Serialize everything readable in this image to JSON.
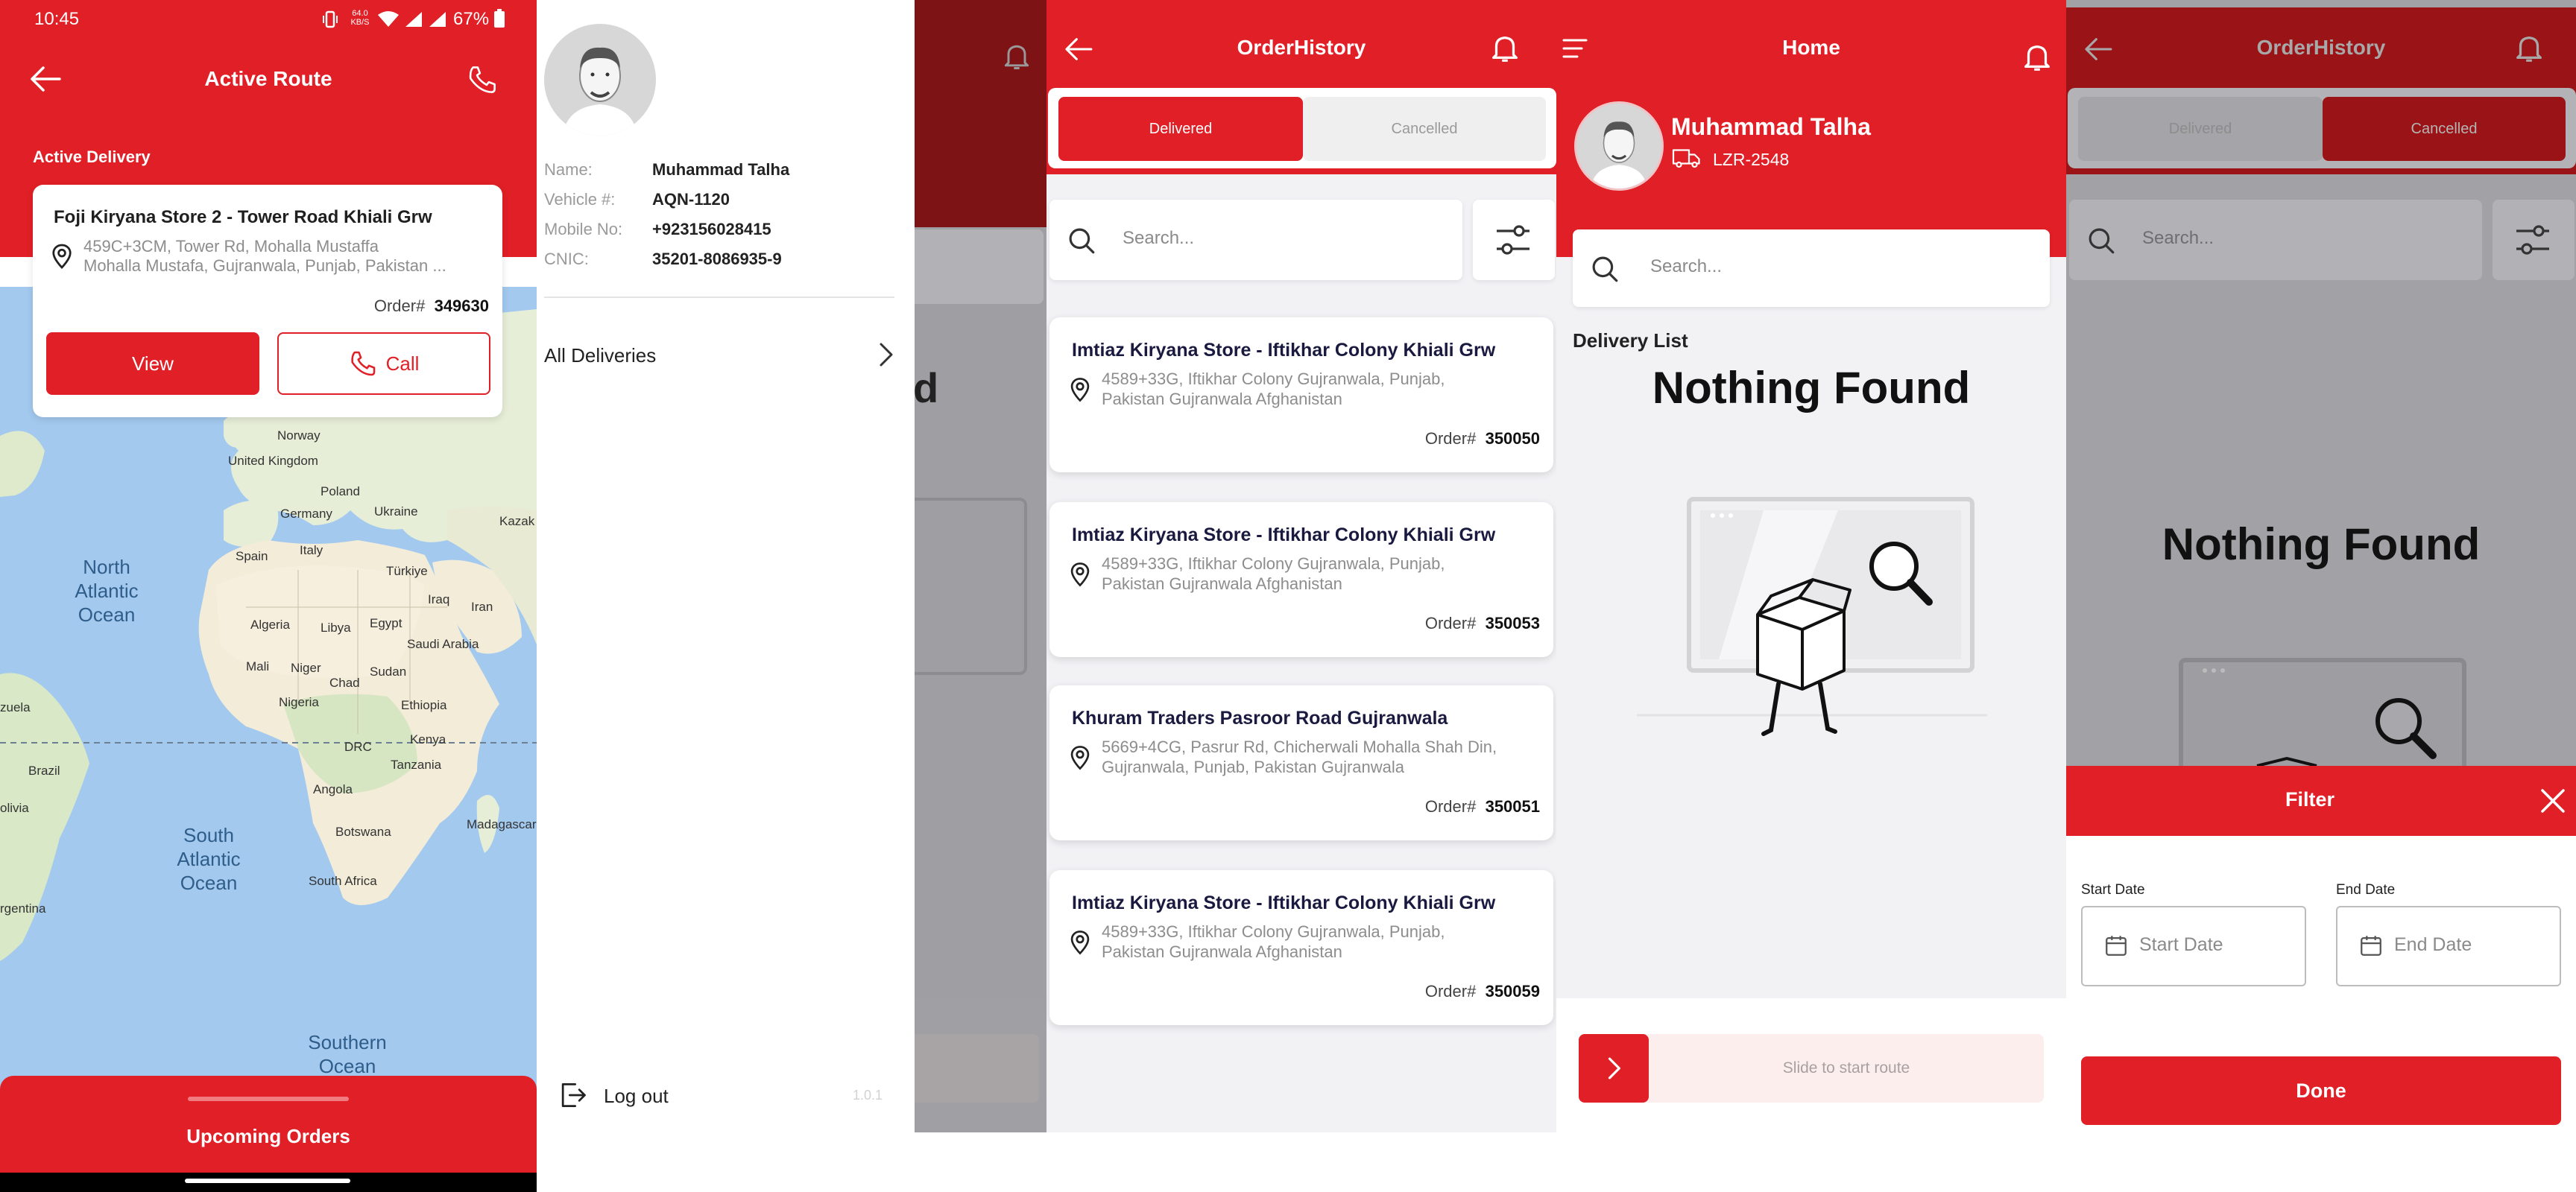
{
  "colors": {
    "primary": "#e11f26",
    "dark_primary": "#9c1318",
    "background": "#f2f1f4"
  },
  "status_bar": {
    "time": "10:45",
    "speed": "64.0 KB/S",
    "battery": "67%"
  },
  "active_route": {
    "title": "Active Route",
    "section_label": "Active Delivery",
    "store_name": "Foji  Kiryana Store 2 - Tower Road Khiali Grw",
    "address_line1": "459C+3CM, Tower Rd, Mohalla Mustaffa",
    "address_line2": "Mohalla Mustafa, Gujranwala, Punjab, Pakistan ...",
    "order_label": "Order#",
    "order_no": "349630",
    "view_label": "View",
    "call_label": "Call",
    "upcoming_label": "Upcoming Orders",
    "map_labels": {
      "norway": "Norway",
      "uk": "United Kingdom",
      "poland": "Poland",
      "germany": "Germany",
      "ukraine": "Ukraine",
      "kazak": "Kazak",
      "spain": "Spain",
      "italy": "Italy",
      "turkiye": "Türkiye",
      "iraq": "Iraq",
      "iran": "Iran",
      "algeria": "Algeria",
      "libya": "Libya",
      "egypt": "Egypt",
      "saudi": "Saudi Arabia",
      "mali": "Mali",
      "niger": "Niger",
      "chad": "Chad",
      "sudan": "Sudan",
      "ethiopia": "Ethiopia",
      "nigeria": "Nigeria",
      "kenya": "Kenya",
      "drc": "DRC",
      "tanzania": "Tanzania",
      "angola": "Angola",
      "brazil": "Brazil",
      "bolivia": "olivia",
      "zuela": "zuela",
      "botswana": "Botswana",
      "madagascar": "Madagascar",
      "south_africa": "South Africa",
      "argentina": "rgentina",
      "north_atlantic": "North Atlantic Ocean",
      "south_atlantic": "South Atlantic Ocean",
      "southern_ocean": "Southern Ocean"
    }
  },
  "drawer": {
    "fields": [
      {
        "label": "Name:",
        "value": "Muhammad Talha"
      },
      {
        "label": "Vehicle #:",
        "value": "AQN-1120"
      },
      {
        "label": "Mobile No:",
        "value": "+923156028415"
      },
      {
        "label": "CNIC:",
        "value": "35201-8086935-9"
      }
    ],
    "all_deliveries": "All Deliveries",
    "logout": "Log out",
    "version": "1.0.1",
    "behind_text": "d"
  },
  "order_history": {
    "title": "OrderHistory",
    "tab_delivered": "Delivered",
    "tab_cancelled": "Cancelled",
    "search_placeholder": "Search...",
    "orders": [
      {
        "name": "Imtiaz Kiryana Store - Iftikhar Colony Khiali Grw",
        "addr1": "4589+33G, Iftikhar Colony Gujranwala, Punjab,",
        "addr2": "Pakistan Gujranwala Afghanistan",
        "order_label": "Order#",
        "order_no": "350050"
      },
      {
        "name": "Imtiaz Kiryana Store - Iftikhar Colony Khiali Grw",
        "addr1": "4589+33G, Iftikhar Colony Gujranwala, Punjab,",
        "addr2": "Pakistan Gujranwala Afghanistan",
        "order_label": "Order#",
        "order_no": "350053"
      },
      {
        "name": "Khuram Traders Pasroor Road Gujranwala",
        "addr1": "5669+4CG, Pasrur Rd, Chicherwali Mohalla Shah Din,",
        "addr2": "Gujranwala, Punjab, Pakistan Gujranwala",
        "order_label": "Order#",
        "order_no": "350051"
      },
      {
        "name": "Imtiaz Kiryana Store - Iftikhar Colony Khiali Grw",
        "addr1": "4589+33G, Iftikhar Colony Gujranwala, Punjab,",
        "addr2": "Pakistan Gujranwala Afghanistan",
        "order_label": "Order#",
        "order_no": "350059"
      }
    ]
  },
  "home": {
    "title": "Home",
    "user_name": "Muhammad Talha",
    "vehicle": "LZR-2548",
    "search_placeholder": "Search...",
    "delivery_list_label": "Delivery List",
    "nothing_found": "Nothing Found",
    "slide_label": "Slide to start route"
  },
  "filter_screen": {
    "title": "OrderHistory",
    "tab_delivered": "Delivered",
    "tab_cancelled": "Cancelled",
    "search_placeholder": "Search...",
    "nothing_found": "Nothing Found",
    "filter_title": "Filter",
    "start_label": "Start Date",
    "start_placeholder": "Start Date",
    "end_label": "End Date",
    "end_placeholder": "End Date",
    "done_label": "Done"
  }
}
